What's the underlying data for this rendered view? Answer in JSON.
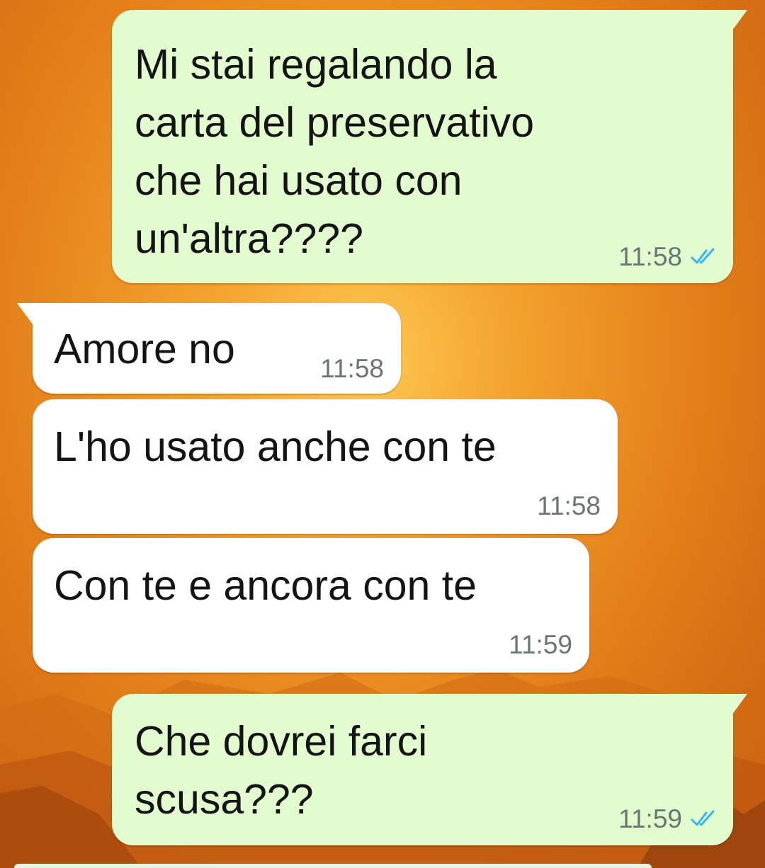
{
  "chat": {
    "messages": [
      {
        "direction": "outgoing",
        "text": "Mi stai regalando la\ncarta del preservativo\nche hai usato con\nun'altra????",
        "time": "11:58",
        "status": "read"
      },
      {
        "direction": "incoming",
        "text": "Amore no",
        "time": "11:58"
      },
      {
        "direction": "incoming",
        "text": "L'ho usato anche con te",
        "time": "11:58"
      },
      {
        "direction": "incoming",
        "text": "Con te e ancora con te",
        "time": "11:59"
      },
      {
        "direction": "outgoing",
        "text": "Che dovrei farci\nscusa???",
        "time": "11:59",
        "status": "read"
      }
    ]
  },
  "theme": {
    "outgoing_bubble": "#e2fbcf",
    "incoming_bubble": "#ffffff",
    "read_tick_color": "#34b7f1",
    "wallpaper": "orange sunset over mountains",
    "icons": {
      "read_receipt": "double-check-icon"
    }
  }
}
